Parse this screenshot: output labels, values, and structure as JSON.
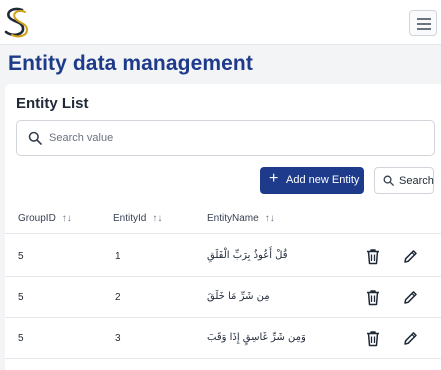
{
  "header": {
    "logo_icon": "brand-s-logo-icon",
    "menu_icon": "hamburger-menu-icon"
  },
  "page": {
    "title": "Entity data management"
  },
  "card": {
    "title": "Entity List",
    "search": {
      "placeholder": "Search value",
      "value": ""
    },
    "add_button_label": "Add new Entity",
    "search_button_label": "Search"
  },
  "table": {
    "columns": [
      {
        "label": "GroupID",
        "sortable": true
      },
      {
        "label": "EntityId",
        "sortable": true
      },
      {
        "label": "EntityName",
        "sortable": true
      }
    ],
    "rows": [
      {
        "group_id": "5",
        "entity_id": "1",
        "entity_name": "قُلْ أَعُوذُ بِرَبِّ الْفَلَقِ"
      },
      {
        "group_id": "5",
        "entity_id": "2",
        "entity_name": "مِن شَرِّ مَا خَلَقَ"
      },
      {
        "group_id": "5",
        "entity_id": "3",
        "entity_name": "وَمِن شَرِّ غَاسِقٍ إِذَا وَقَبَ"
      }
    ],
    "row_actions": [
      "delete-icon",
      "edit-icon"
    ]
  },
  "colors": {
    "accent": "#1e3a8a",
    "logo_gold": "#d4a017",
    "logo_dark": "#1f2937",
    "background": "#f3f4f6"
  }
}
